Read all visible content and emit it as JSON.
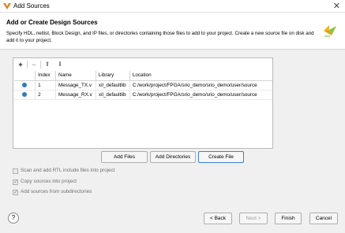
{
  "window": {
    "title": "Add Sources",
    "close_glyph": "✕"
  },
  "header": {
    "heading": "Add or Create Design Sources",
    "description": "Specify HDL, netlist, Block Design, and IP files, or directories containing those files to add to your project. Create a new source file on disk and add it to your project."
  },
  "toolbar": {
    "add": "+",
    "remove": "−",
    "move_up": "⬆",
    "move_down": "⬇"
  },
  "table": {
    "columns": [
      "",
      "Index",
      "Name",
      "Library",
      "Location"
    ],
    "rows": [
      {
        "index": "1",
        "name": "Message_TX.v",
        "library": "xil_defaultlib",
        "location": "C:/work/project/FPGA/srio_demo/srio_demo/user/source"
      },
      {
        "index": "2",
        "name": "Message_RX.v",
        "library": "xil_defaultlib",
        "location": "C:/work/project/FPGA/srio_demo/srio_demo/user/source"
      }
    ]
  },
  "buttons": {
    "add_files": "Add Files",
    "add_directories": "Add Directories",
    "create_file": "Create File",
    "back": "< Back",
    "next": "Next >",
    "finish": "Finish",
    "cancel": "Cancel",
    "help": "?"
  },
  "options": {
    "scan_rtl": {
      "label": "Scan and add RTL include files into project",
      "checked": false
    },
    "copy_sources": {
      "label": "Copy sources into project",
      "checked": true
    },
    "add_subdirs": {
      "label": "Add sources from subdirectories",
      "checked": true
    }
  },
  "colors": {
    "status_dot": "#2e7fb8",
    "primary_border": "#3c7fd3"
  }
}
